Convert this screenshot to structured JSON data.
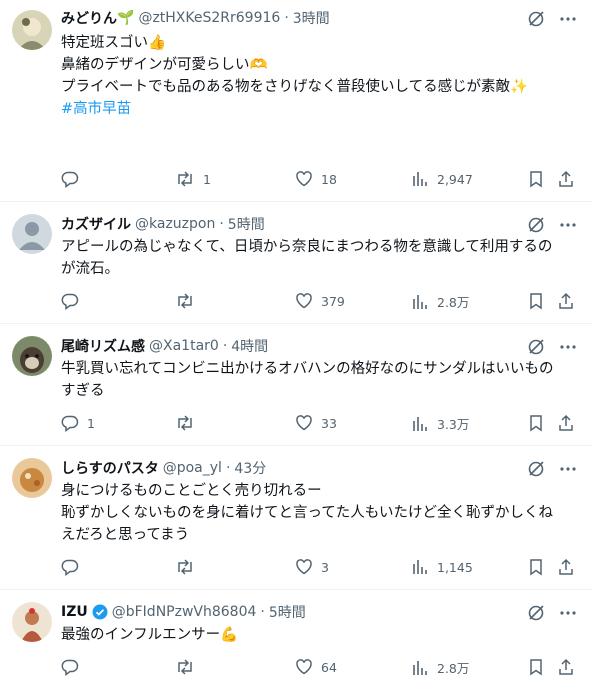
{
  "tweets": [
    {
      "name": "みどりん",
      "name_emoji": "🌱",
      "handle": "@ztHXKeS2Rr69916",
      "time": "3時間",
      "lines": [
        "特定班スゴい👍",
        "",
        "鼻緒のデザインが可愛らしい🫶",
        "プライベートでも品のある物をさりげなく普段使いしてる感じが素敵✨",
        ""
      ],
      "hashtag": "#高市早苗",
      "replies": "",
      "retweets": "1",
      "likes": "18",
      "views": "2,947",
      "avatar_color": "#c9c6a6"
    },
    {
      "name": "カズザイル",
      "name_emoji": "",
      "handle": "@kazuzpon",
      "time": "5時間",
      "lines": [
        "アピールの為じゃなくて、日頃から奈良にまつわる物を意識して利用するの",
        "が流石。"
      ],
      "hashtag": "",
      "replies": "",
      "retweets": "",
      "likes": "379",
      "views": "2.8万",
      "avatar_color": "#cfd9de"
    },
    {
      "name": "尾崎リズム感",
      "name_emoji": "",
      "handle": "@Xa1tar0",
      "time": "4時間",
      "lines": [
        "牛乳買い忘れてコンビニ出かけるオバハンの格好なのにサンダルはいいもの",
        "すぎる"
      ],
      "hashtag": "",
      "replies": "1",
      "retweets": "",
      "likes": "33",
      "views": "3.3万",
      "avatar_color": "#6b6f5a"
    },
    {
      "name": "しらすのパスタ",
      "name_emoji": "",
      "handle": "@poa_yl",
      "time": "43分",
      "lines": [
        "身につけるものことごとく売り切れるー",
        "恥ずかしくないものを身に着けてと言ってた人もいたけど全く恥ずかしくね",
        "えだろと思ってまう"
      ],
      "hashtag": "",
      "replies": "",
      "retweets": "",
      "likes": "3",
      "views": "1,145",
      "avatar_color": "#d9a46a"
    },
    {
      "name": "IZU",
      "name_emoji": "",
      "handle": "@bFIdNPzwVh86804",
      "time": "5時間",
      "lines": [
        "最強のインフルエンサー💪"
      ],
      "hashtag": "",
      "replies": "",
      "retweets": "",
      "likes": "64",
      "views": "2.8万",
      "avatar_color": "#e7d8c4"
    }
  ],
  "colors": {
    "secondary": "#536471",
    "accent": "#1d9bf0",
    "verified": "#1d9bf0"
  },
  "icons": [
    "grok-icon",
    "more-icon",
    "reply-icon",
    "retweet-icon",
    "like-icon",
    "views-icon",
    "bookmark-icon",
    "share-icon",
    "verified-icon"
  ]
}
